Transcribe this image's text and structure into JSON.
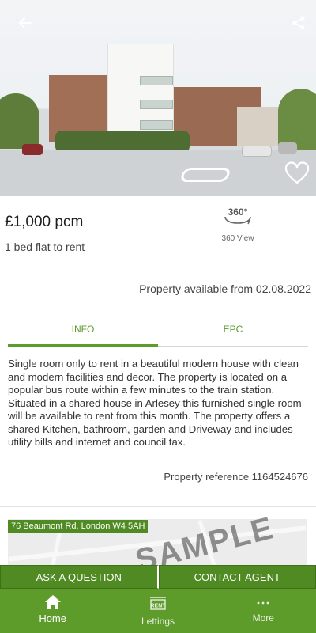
{
  "hero": {
    "back_icon": "arrow-left-icon",
    "share_icon": "share-icon",
    "favourite_icon": "heart-outline-icon"
  },
  "listing": {
    "price": "£1,000 pcm",
    "type": "1 bed flat to rent",
    "view360_badge": "360°",
    "view360_label": "360 View",
    "available": "Property available from 02.08.2022"
  },
  "tabs": [
    {
      "label": "INFO",
      "active": true
    },
    {
      "label": "EPC",
      "active": false
    }
  ],
  "description": "Single room only to rent in a beautiful modern house with clean and modern facilities and decor. The property is located on a popular bus route within a few minutes to the train station. Situated in a shared house in Arlesey this furnished single room will be available to rent from this month. The property offers a shared Kitchen, bathroom, garden and Driveway and includes utility bills and internet and council tax.",
  "reference": "Property reference 1164524676",
  "map": {
    "address": "76 Beaumont Rd, London W4 5AH",
    "watermark": "SAMPLE"
  },
  "actions": {
    "ask": "ASK A QUESTION",
    "contact": "CONTACT AGENT"
  },
  "bottom_nav": [
    {
      "label": "Home",
      "icon": "home-icon",
      "active": true
    },
    {
      "label": "Lettings",
      "icon": "rent-sign-icon",
      "badge": "RENT",
      "active": false
    },
    {
      "label": "More",
      "icon": "more-dots-icon",
      "active": false
    }
  ],
  "colors": {
    "brand_green": "#5d9b2b",
    "button_green": "#4f8a22"
  }
}
